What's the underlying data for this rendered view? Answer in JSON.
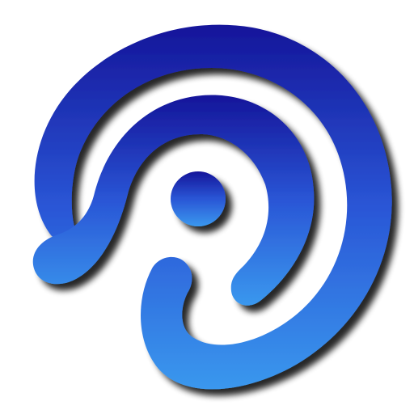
{
  "logo": {
    "icon": "spiral-dot-logo-icon",
    "colors": {
      "gradient_top": "#15159a",
      "gradient_mid": "#2a56d6",
      "gradient_bottom": "#3a98ee",
      "shadow": "#000000",
      "background": "#ffffff"
    }
  }
}
